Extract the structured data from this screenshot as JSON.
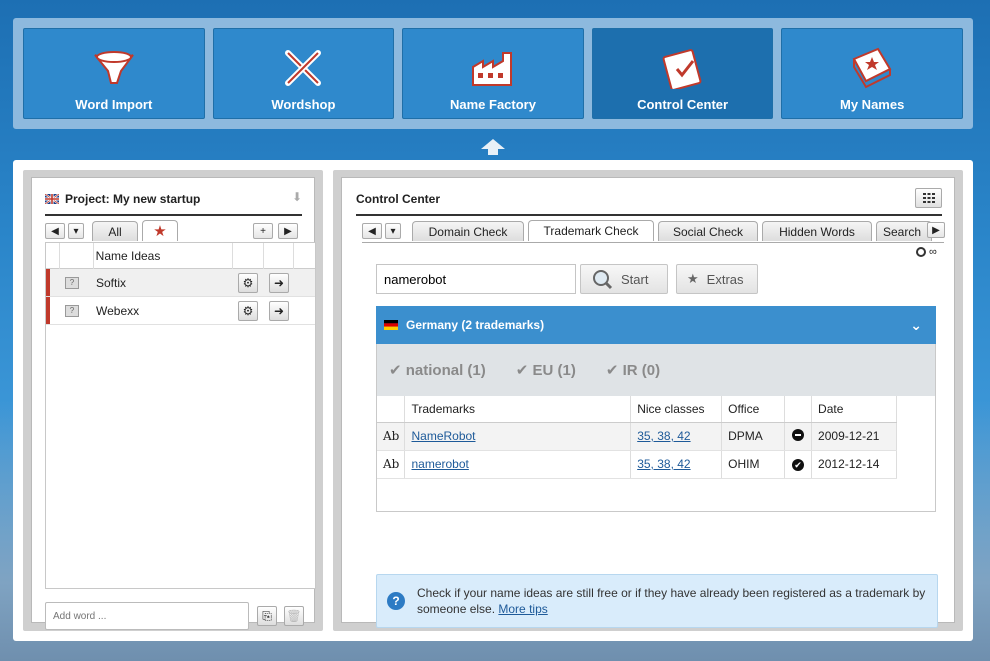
{
  "nav": {
    "tiles": [
      {
        "label": "Word Import",
        "icon": "funnel-icon"
      },
      {
        "label": "Wordshop",
        "icon": "tools-icon"
      },
      {
        "label": "Name Factory",
        "icon": "factory-icon"
      },
      {
        "label": "Control Center",
        "icon": "clipboard-check-icon"
      },
      {
        "label": "My Names",
        "icon": "book-star-icon"
      }
    ],
    "active": "Control Center"
  },
  "left_panel": {
    "title": "Project: My new startup",
    "tabs": [
      "All",
      "★"
    ],
    "column_header": "Name Ideas",
    "rows": [
      {
        "name": "Softix"
      },
      {
        "name": "Webexx"
      }
    ],
    "add_word_placeholder": "Add word ..."
  },
  "right_panel": {
    "title": "Control Center",
    "tabs": [
      "Domain Check",
      "Trademark Check",
      "Social Check",
      "Hidden Words",
      "Search"
    ],
    "active_tab": "Trademark Check",
    "infinity": "∞",
    "search_value": "namerobot",
    "start_label": "Start",
    "extras_label": "Extras",
    "country_header": "Germany (2 trademarks)",
    "filters": [
      "national (1)",
      "EU (1)",
      "IR (0)"
    ],
    "table": {
      "headers": [
        "Trademarks",
        "Nice classes",
        "Office",
        "",
        "Date"
      ],
      "rows": [
        {
          "ab": "Ab",
          "name": "NameRobot",
          "classes": "35, 38, 42",
          "office": "DPMA",
          "status": "blocked",
          "date": "2009-12-21"
        },
        {
          "ab": "Ab",
          "name": "namerobot",
          "classes": "35, 38, 42",
          "office": "OHIM",
          "status": "ok",
          "date": "2012-12-14"
        }
      ]
    },
    "tip": {
      "text": "Check if your name ideas are still free or if they have already been registered as a trademark by someone else.",
      "link": "More tips"
    }
  },
  "colors": {
    "nav_tile": "#2f89cc",
    "nav_active": "#1d6fae",
    "country_header": "#3b8fce",
    "name_marker": "#c0392b"
  }
}
